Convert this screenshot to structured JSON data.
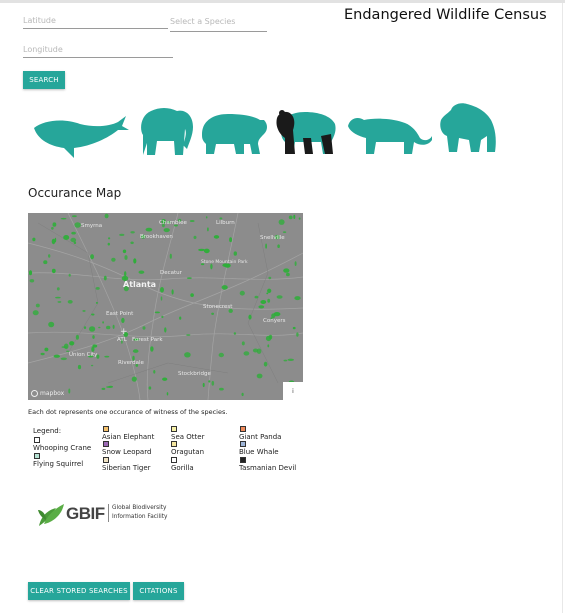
{
  "page_title": "Endangered Wildlife Census",
  "search_form": {
    "latitude_placeholder": "Latitude",
    "longitude_placeholder": "Longitude",
    "species_placeholder": "Select a Species",
    "search_label": "SEARCH"
  },
  "animals": [
    "whale",
    "elephant",
    "bear",
    "panda",
    "tiger",
    "gorilla"
  ],
  "map": {
    "heading": "Occurance Map",
    "labels": [
      "Chamblee",
      "Lilburn",
      "Smyrna",
      "Brookhaven",
      "Snellville",
      "Stone Mountain Park",
      "Decatur",
      "Atlanta",
      "East Point",
      "Stonecrest",
      "Conyers",
      "ATL",
      "Forest Park",
      "Union City",
      "Riverdale",
      "Stockbridge"
    ],
    "attribution": "mapbox",
    "info": "i",
    "caption": "Each dot represents one occurance of witness of the species."
  },
  "legend": {
    "title": "Legend:",
    "items": [
      {
        "name": "Asian Elephant",
        "color": "#f5c16c"
      },
      {
        "name": "Sea Otter",
        "color": "#f7f1a8"
      },
      {
        "name": "Giant Panda",
        "color": "#f08a5a"
      },
      {
        "name": "Whooping Crane",
        "color": "#ffffff"
      },
      {
        "name": "Snow Leopard",
        "color": "#9c6ab5"
      },
      {
        "name": "Oragutan",
        "color": "#f5e7a0"
      },
      {
        "name": "Blue Whale",
        "color": "#9fb6d9"
      },
      {
        "name": "Flying Squirrel",
        "color": "#b6e3d4"
      },
      {
        "name": "Siberian Tiger",
        "color": "#f0e2c2"
      },
      {
        "name": "Gorilla",
        "color": "#ffffff"
      },
      {
        "name": "Tasmanian Devil",
        "color": "#222222"
      }
    ]
  },
  "gbif": {
    "logo_text": "GBIF",
    "full_name_line1": "Global Biodiversity",
    "full_name_line2": "Information Facility"
  },
  "buttons": {
    "clear_label": "CLEAR STORED SEARCHES",
    "citations_label": "CITATIONS"
  },
  "colors": {
    "accent": "#26a69a",
    "map_bg": "#8a8a8a",
    "dot": "#2fae3a"
  }
}
